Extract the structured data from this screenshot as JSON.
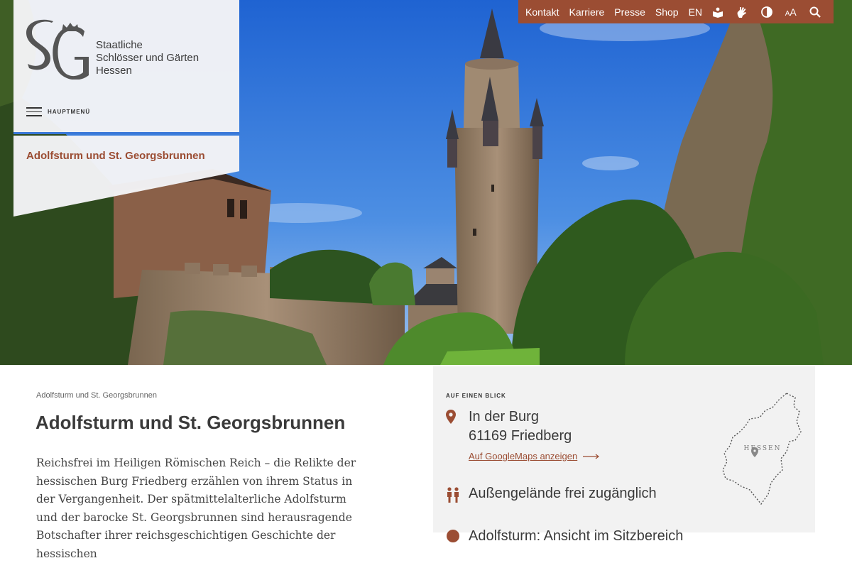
{
  "topnav": {
    "links": [
      "Kontakt",
      "Karriere",
      "Presse",
      "Shop",
      "EN"
    ],
    "aa_small": "A",
    "aa_large": "A",
    "icons": [
      "easy-language-icon",
      "sign-language-icon",
      "contrast-icon",
      "font-size-icon",
      "search-icon"
    ]
  },
  "logo": {
    "mark": "SG",
    "line1": "Staatliche",
    "line2": "Schlösser und Gärten",
    "line3": "Hessen"
  },
  "menu": {
    "label": "HAUPTMENÜ"
  },
  "hero": {
    "page_label": "Adolfsturm und St. Georgsbrunnen"
  },
  "breadcrumb": "Adolfsturm und St. Georgsbrunnen",
  "page_title": "Adolfsturm und St. Georgsbrunnen",
  "intro": "Reichsfrei im Heiligen Römischen Reich – die Relikte der hessischen Burg Friedberg erzählen von ihrem Status in der Vergangenheit. Der spätmittelalterliche Adolfsturm und der barocke St. Georgsbrunnen sind herausragende Botschafter ihrer reichsgeschichtigen Geschichte der hessischen",
  "info": {
    "kicker": "AUF EINEN BLICK",
    "address_line1": "In der Burg",
    "address_line2": "61169 Friedberg",
    "map_link": "Auf GoogleMaps anzeigen",
    "access": "Außengelände frei zugänglich",
    "cut_line": "Adolfsturm: Ansicht im Sitzbereich",
    "map_label": "HESSEN"
  },
  "colors": {
    "accent": "#9b4d33",
    "blue": "#3a78d8",
    "panel": "#f2f2f2"
  }
}
